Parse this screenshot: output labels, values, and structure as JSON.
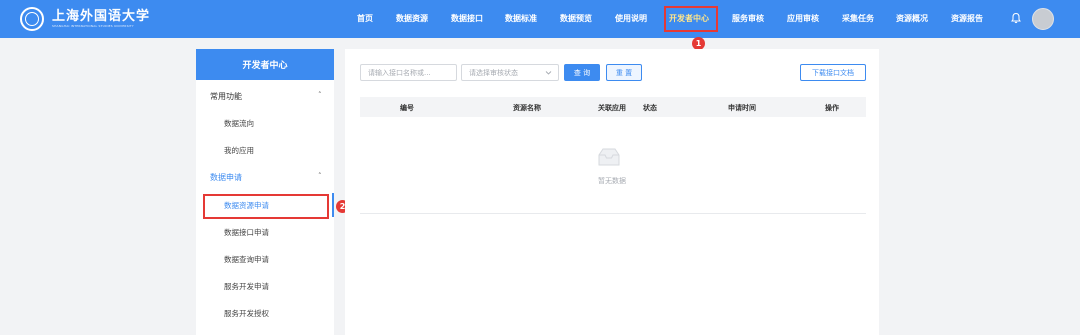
{
  "header": {
    "logo": {
      "name_cn": "上海外国语大学",
      "name_en": "SHANGHAI INTERNATIONAL STUDIES UNIVERSITY"
    },
    "nav": [
      {
        "label": "首页"
      },
      {
        "label": "数据资源"
      },
      {
        "label": "数据接口"
      },
      {
        "label": "数据标准"
      },
      {
        "label": "数据预览"
      },
      {
        "label": "使用说明"
      },
      {
        "label": "开发者中心",
        "active": true
      },
      {
        "label": "服务审核"
      },
      {
        "label": "应用审核"
      },
      {
        "label": "采集任务"
      },
      {
        "label": "资源概况"
      },
      {
        "label": "资源报告"
      }
    ],
    "icons": [
      "bell-icon",
      "avatar"
    ]
  },
  "annotations": {
    "marker_1": "1",
    "marker_2": "2",
    "color": "#e53935"
  },
  "sidebar": {
    "title": "开发者中心",
    "groups": [
      {
        "label": "常用功能",
        "caret": "˄",
        "items": [
          {
            "label": "数据流向"
          },
          {
            "label": "我的应用"
          }
        ]
      },
      {
        "label": "数据申请",
        "caret": "˄",
        "active": true,
        "items": [
          {
            "label": "数据资源申请",
            "active": true
          },
          {
            "label": "数据接口申请"
          },
          {
            "label": "数据查询申请"
          },
          {
            "label": "服务开发申请"
          },
          {
            "label": "服务开发授权"
          }
        ]
      }
    ]
  },
  "main": {
    "filters": {
      "search_placeholder": "请输入接口名称或...",
      "status_placeholder": "请选择审核状态",
      "query_button": "查 询",
      "reset_button": "重 置",
      "download_button": "下载接口文档"
    },
    "table": {
      "columns": [
        "编号",
        "资源名称",
        "关联应用",
        "状态",
        "申请时间",
        "操作"
      ],
      "rows": [],
      "empty_text": "暂无数据"
    }
  },
  "colors": {
    "primary": "#3d8bf0",
    "nav_active": "#ffe58a",
    "highlight": "#e53935"
  }
}
